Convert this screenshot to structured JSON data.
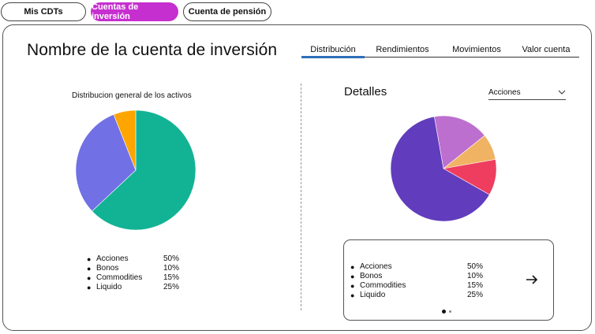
{
  "topnav": {
    "items": [
      {
        "label": "Mis CDTs"
      },
      {
        "label": "Cuentas de inversión"
      },
      {
        "label": "Cuenta de pensión"
      }
    ],
    "active_color": "#c62fcf"
  },
  "account": {
    "title": "Nombre de la cuenta de inversión"
  },
  "tabs": [
    {
      "label": "Distribución"
    },
    {
      "label": "Rendimientos"
    },
    {
      "label": "Movimientos"
    },
    {
      "label": "Valor cuenta"
    }
  ],
  "active_tab_color": "#2d6fb8",
  "left_panel": {
    "title": "Distribucion general de los activos",
    "legend": [
      {
        "label": "Acciones",
        "value": "50%"
      },
      {
        "label": "Bonos",
        "value": "10%"
      },
      {
        "label": "Commodities",
        "value": "15%"
      },
      {
        "label": "Liquido",
        "value": "25%"
      }
    ]
  },
  "right_panel": {
    "title": "Detalles",
    "select": {
      "value": "Acciones"
    },
    "legend": [
      {
        "label": "Acciones",
        "value": "50%"
      },
      {
        "label": "Bonos",
        "value": "10%"
      },
      {
        "label": "Commodities",
        "value": "15%"
      },
      {
        "label": "Liquido",
        "value": "25%"
      }
    ],
    "carousel": {
      "pages": 2,
      "current": 1
    }
  },
  "chart_data": [
    {
      "type": "pie",
      "title": "Distribucion general de los activos",
      "start_angle_deg": 0,
      "slices": [
        {
          "value": 63,
          "color": "#12b394"
        },
        {
          "value": 31,
          "color": "#7170e4"
        },
        {
          "value": 6,
          "color": "#ffa500"
        }
      ]
    },
    {
      "type": "pie",
      "title": "",
      "start_angle_deg": -10,
      "slices": [
        {
          "value": 17,
          "color": "#bc6fce"
        },
        {
          "value": 8,
          "color": "#f0b263"
        },
        {
          "value": 11,
          "color": "#ee3d5f"
        },
        {
          "value": 64,
          "color": "#613dbd"
        }
      ]
    }
  ]
}
